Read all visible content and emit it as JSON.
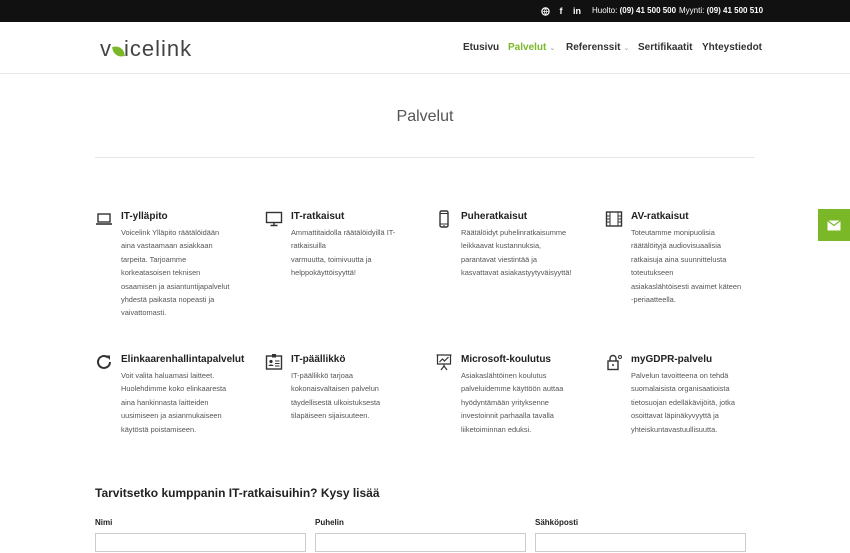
{
  "topbar": {
    "social": [
      {
        "name": "globe-icon",
        "glyph": "◉"
      },
      {
        "name": "facebook-icon",
        "glyph": "f"
      },
      {
        "name": "linkedin-icon",
        "glyph": "in"
      }
    ],
    "support_label": "Huolto:",
    "support_phone": "(09) 41 500 500",
    "sales_label": "Myynti:",
    "sales_phone": "(09) 41 500 510"
  },
  "header": {
    "logo_left": "v",
    "logo_right": "icelink",
    "nav": [
      {
        "label": "Etusivu",
        "active": false,
        "caret": ""
      },
      {
        "label": "Palvelut",
        "active": true,
        "caret": "⌄"
      },
      {
        "label": "Referenssit",
        "active": false,
        "caret": "⌄"
      },
      {
        "label": "Sertifikaatit",
        "active": false,
        "caret": ""
      },
      {
        "label": "Yhteystiedot",
        "active": false,
        "caret": ""
      }
    ]
  },
  "page": {
    "title": "Palvelut"
  },
  "services": [
    {
      "icon": "laptop-icon",
      "title": "IT-ylläpito",
      "lines": [
        "Voicelink Ylläpito räätälöidään",
        "aina vastaamaan asiakkaan",
        "tarpeita. Tarjoamme",
        "korkeatasoisen teknisen",
        "osaamisen ja asiantuntijapalvelut",
        "yhdestä paikasta nopeasti ja",
        "vaivattomasti."
      ]
    },
    {
      "icon": "monitor-icon",
      "title": "IT-ratkaisut",
      "lines": [
        "Ammattitaidolla räätälöidyillä IT-",
        "ratkaisuilla",
        "varmuutta, toimivuutta ja",
        "helppokäyttöisyyttä!"
      ]
    },
    {
      "icon": "smartphone-icon",
      "title": "Puheratkaisut",
      "lines": [
        "Räätälöidyt puhelinratkaisumme",
        "leikkaavat kustannuksia,",
        "parantavat viestintää ja",
        "kasvattavat asiakastyytyväisyyttä!"
      ]
    },
    {
      "icon": "film-icon",
      "title": "AV-ratkaisut",
      "lines": [
        "Toteutamme monipuolisia",
        "räätälöityjä audiovisuaalisia",
        "ratkaisuja aina suunnittelusta",
        "toteutukseen",
        "asiakaslähtöisesti avaimet käteen",
        "-periaatteella."
      ]
    },
    {
      "icon": "refresh-icon",
      "title": "Elinkaarenhallintapalvelut",
      "lines": [
        "Voit valita haluamasi laitteet.",
        "Huolehdimme koko elinkaaresta",
        "aina hankinnasta laitteiden",
        "uusimiseen ja asianmukaiseen",
        "käytöstä poistamiseen."
      ]
    },
    {
      "icon": "id-card-icon",
      "title": "IT-päällikkö",
      "lines": [
        "IT-päällikkö tarjoaa",
        "kokonaisvaltaisen palvelun",
        "täydellisestä ulkoistuksesta",
        "tilapäiseen sijaisuuteen."
      ]
    },
    {
      "icon": "presentation-chart-icon",
      "title": "Microsoft-koulutus",
      "lines": [
        "Asiakaslähtöinen koulutus",
        "palveluidemme käyttöön auttaa",
        "hyödyntämään yrityksenne",
        "investoinnit parhaalla tavalla",
        "liiketoiminnan eduksi."
      ]
    },
    {
      "icon": "lock-icon",
      "title": "myGDPR-palvelu",
      "lines": [
        "Palvelun tavoitteena on tehdä",
        "suomalaisista organisaatioista",
        "tietosuojan edelläkävijöitä, jotka",
        "osoittavat läpinäkyvyyttä ja",
        "yhteiskuntavastuullisuutta."
      ]
    }
  ],
  "form": {
    "heading": "Tarvitsetko kumppanin IT-ratkaisuihin? Kysy lisää",
    "fields": [
      {
        "label": "Nimi",
        "value": ""
      },
      {
        "label": "Puhelin",
        "value": ""
      },
      {
        "label": "Sähköposti",
        "value": ""
      }
    ]
  },
  "colors": {
    "accent": "#7ab828",
    "topbar": "#111111"
  }
}
